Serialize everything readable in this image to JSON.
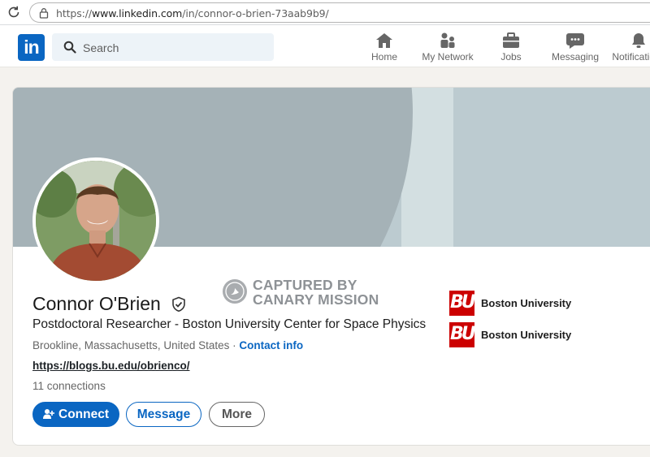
{
  "browser": {
    "url_prefix": "https://",
    "url_host": "www.linkedin.com",
    "url_path": "/in/connor-o-brien-73aab9b9/"
  },
  "header": {
    "logo": "in",
    "search_placeholder": "Search",
    "nav": [
      {
        "label": "Home",
        "icon": "home-icon"
      },
      {
        "label": "My Network",
        "icon": "network-icon"
      },
      {
        "label": "Jobs",
        "icon": "briefcase-icon"
      },
      {
        "label": "Messaging",
        "icon": "messaging-icon"
      },
      {
        "label": "Notifications",
        "icon": "bell-icon"
      }
    ]
  },
  "watermark": {
    "line1": "CAPTURED BY",
    "line2": "CANARY MISSION"
  },
  "profile": {
    "name": "Connor O'Brien",
    "headline": "Postdoctoral Researcher - Boston University Center for Space Physics",
    "location": "Brookline, Massachusetts, United States",
    "separator": " · ",
    "contact_info": "Contact info",
    "website": "https://blogs.bu.edu/obrienco/",
    "connections": "11 connections",
    "education": [
      {
        "name": "Boston University",
        "logo": "BU"
      },
      {
        "name": "Boston University",
        "logo": "BU"
      }
    ]
  },
  "actions": {
    "connect": "Connect",
    "message": "Message",
    "more": "More"
  },
  "colors": {
    "brand": "#0a66c2",
    "banner": "#a5b2b7",
    "bu_red": "#cc0000"
  }
}
